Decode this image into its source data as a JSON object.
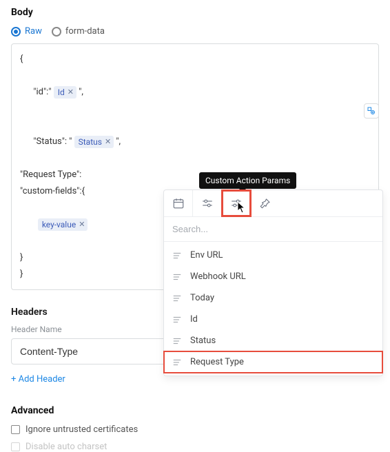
{
  "body": {
    "section_title": "Body",
    "radios": {
      "raw": "Raw",
      "form_data": "form-data"
    },
    "lines": {
      "l0": "{",
      "l1a": "\"id\":\" ",
      "l1b": " \",",
      "l2a": "\"Status\": \" ",
      "l2b": " \",",
      "l3": "\"Request Type\":",
      "l4": "\"custom-fields\":{",
      "l6": "}",
      "l7": "}"
    },
    "chips": {
      "id": "Id",
      "status": "Status",
      "keyvalue": "key-value"
    }
  },
  "headers": {
    "section_title": "Headers",
    "name_label": "Header Name",
    "name_value": "Content-Type",
    "add_label": "+ Add Header"
  },
  "advanced": {
    "section_title": "Advanced",
    "ignore_cert": "Ignore untrusted certificates",
    "disable_charset": "Disable auto charset"
  },
  "tooltip": "Custom Action Params",
  "popover": {
    "search_placeholder": "Search...",
    "items": [
      {
        "label": "Env URL"
      },
      {
        "label": "Webhook URL"
      },
      {
        "label": "Today"
      },
      {
        "label": "Id"
      },
      {
        "label": "Status"
      },
      {
        "label": "Request Type"
      }
    ]
  }
}
